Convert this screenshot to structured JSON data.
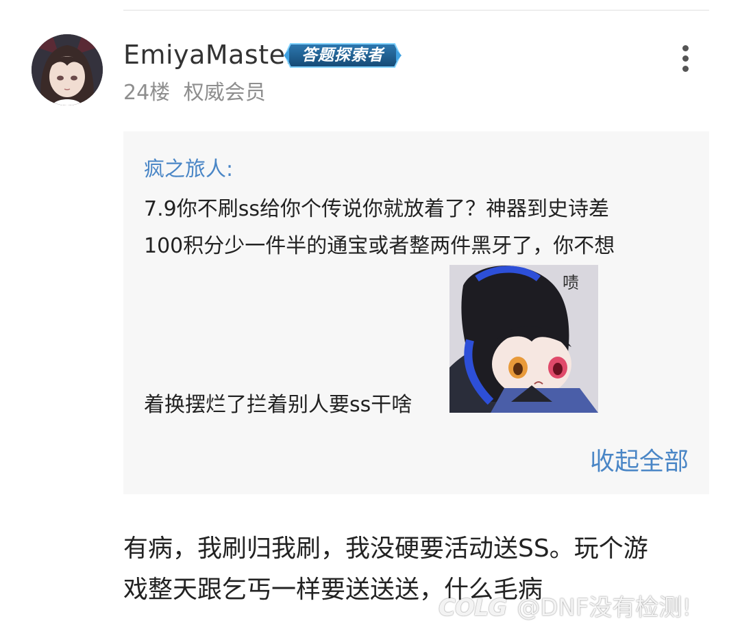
{
  "post": {
    "username": "EmiyaMaster",
    "badge": "答题探索者",
    "floor": "24楼",
    "member_level": "权威会员"
  },
  "quote": {
    "author": "疯之旅人:",
    "lines": [
      "7.9你不刷ss给你个传说你就放着了？神器到史诗差",
      "100积分少一件半的通宝或者整两件黑牙了，你不想",
      "着换摆烂了拦着别人要ss干啥"
    ],
    "sticker_caption": "啧",
    "collapse_label": "收起全部"
  },
  "reply": {
    "lines": [
      "有病，我刷归我刷，我没硬要活动送SS。玩个游",
      "戏整天跟乞丐一样要送送送，什么毛病"
    ]
  },
  "watermark": {
    "logo": "COLG",
    "text": "@DNF没有检测!"
  },
  "colors": {
    "link": "#4a86c6",
    "quote_bg": "#f7f7f7",
    "meta_text": "#8e8e8e",
    "badge_bg": "#1f5d8c"
  },
  "icons": {
    "more": "more-vertical-icon"
  }
}
